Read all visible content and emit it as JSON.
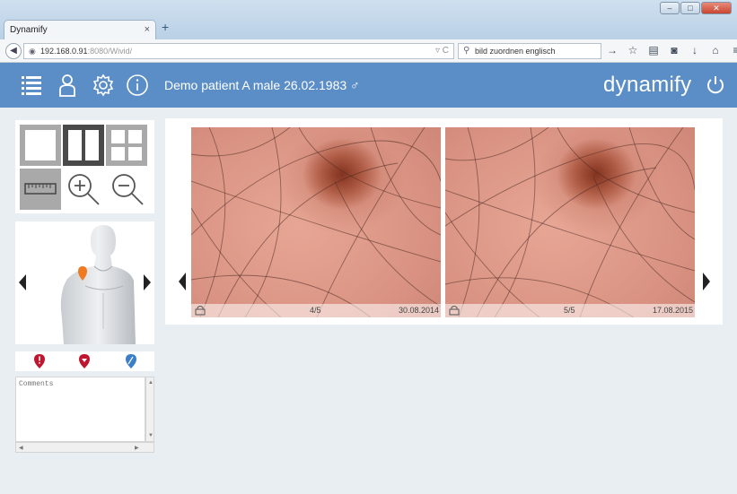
{
  "browser": {
    "tab_title": "Dynamify",
    "tab_close": "×",
    "new_tab": "+",
    "url_host": "192.168.0.91",
    "url_rest": ":8080/Wivid/",
    "search_text": "bild zuordnen englisch",
    "toolbar_icons": [
      "star-icon",
      "reading-list-icon",
      "pocket-icon",
      "download-icon",
      "home-icon",
      "menu-icon"
    ]
  },
  "header": {
    "patient_label": "Demo patient A male 26.02.1983 ♂",
    "brand": "dynamify",
    "icons": [
      "list-icon",
      "user-icon",
      "settings-icon",
      "info-icon",
      "power-icon"
    ],
    "accent_color": "#5b8ec7"
  },
  "layout_tools": {
    "buttons": [
      "single-view-icon",
      "split-view-icon",
      "quad-view-icon",
      "ruler-icon",
      "zoom-in-icon",
      "zoom-out-icon"
    ],
    "active": "split-view-icon"
  },
  "markers": {
    "colors": [
      "#c0152f",
      "#c0152f",
      "#3a7fc8"
    ]
  },
  "comments": {
    "placeholder": "Comments"
  },
  "images": [
    {
      "counter": "4/5",
      "date": "30.08.2014"
    },
    {
      "counter": "5/5",
      "date": "17.08.2015"
    }
  ]
}
